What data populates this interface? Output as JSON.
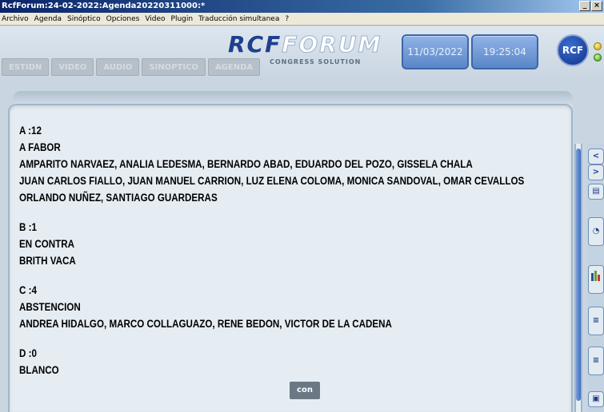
{
  "window": {
    "title": "RcfForum:24-02-2022:Agenda20220311000:*",
    "controls": [
      "_",
      "×"
    ]
  },
  "menu": [
    "Archivo",
    "Agenda",
    "Sinóptico",
    "Opciones",
    "Video",
    "Plugin",
    "Traducción simultanea",
    "?"
  ],
  "tabs": [
    "ESTIDN",
    "VIDEO",
    "AUDIO",
    "SINOPTICO",
    "AGENDA"
  ],
  "logo": {
    "rcf": "RCF",
    "forum": "FORUM",
    "subtitle": "CONGRESS SOLUTION"
  },
  "date": "11/03/2022",
  "time": "19:25:04",
  "badge": "RCF",
  "votes": [
    {
      "code": "A :12",
      "label": "A FABOR",
      "names": [
        "AMPARITO NARVAEZ, ANALIA LEDESMA, BERNARDO ABAD, EDUARDO DEL POZO, GISSELA CHALA",
        "JUAN CARLOS FIALLO, JUAN MANUEL CARRION, LUZ ELENA COLOMA, MONICA SANDOVAL, OMAR CEVALLOS",
        "ORLANDO NUÑEZ, SANTIAGO GUARDERAS"
      ]
    },
    {
      "code": "B :1",
      "label": "EN CONTRA",
      "names": [
        "BRITH VACA"
      ]
    },
    {
      "code": "C :4",
      "label": "ABSTENCION",
      "names": [
        "ANDREA HIDALGO, MARCO COLLAGUAZO, RENE BEDON, VICTOR DE LA CADENA"
      ]
    },
    {
      "code": "D :0",
      "label": "BLANCO",
      "names": []
    }
  ],
  "con_button": "con",
  "side_buttons": {
    "prev": "<",
    "next": ">"
  },
  "colors": {
    "accent": "#3c6ec0",
    "panel": "#e5edf3",
    "brand": "#1f3f8f"
  }
}
